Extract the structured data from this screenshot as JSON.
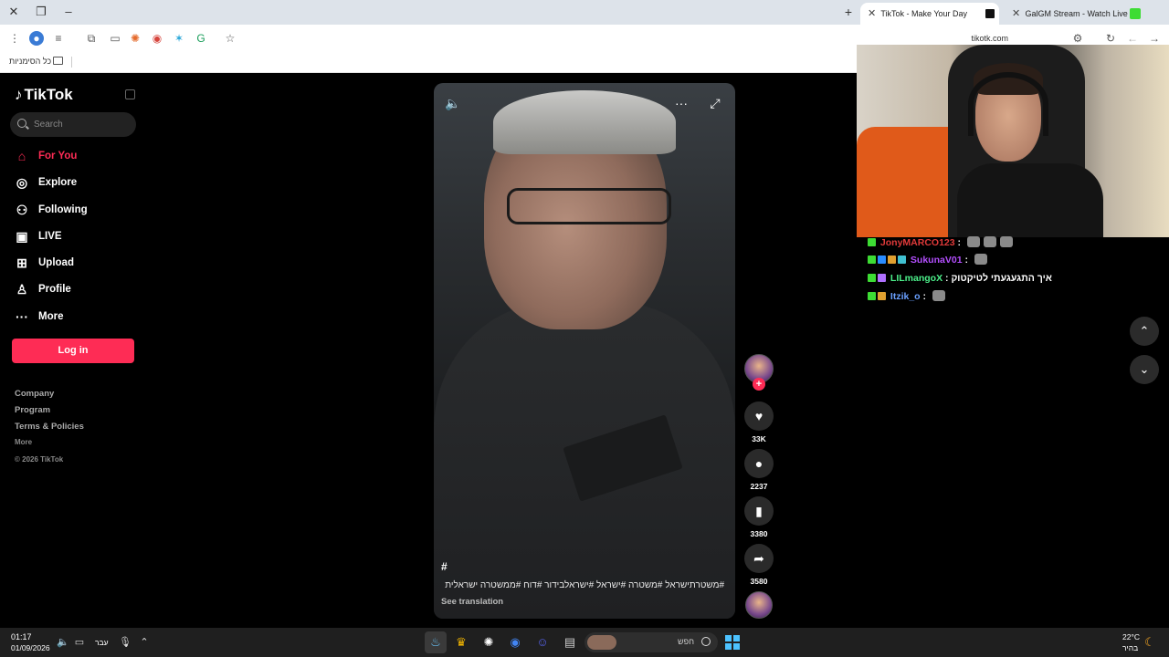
{
  "browser": {
    "tabs": [
      {
        "title": "TikTok - Make Your Day",
        "active": true
      },
      {
        "title": "GalGM Stream - Watch Live on",
        "active": false
      }
    ],
    "url": "tikotk.com",
    "bookmarks_label": "כל הסימניות"
  },
  "sidebar": {
    "logo": "TikTok",
    "search_placeholder": "Search",
    "nav": [
      {
        "label": "For You",
        "icon": "home-icon",
        "active": true
      },
      {
        "label": "Explore",
        "icon": "compass-icon"
      },
      {
        "label": "Following",
        "icon": "following-icon"
      },
      {
        "label": "LIVE",
        "icon": "live-icon"
      },
      {
        "label": "Upload",
        "icon": "upload-icon"
      },
      {
        "label": "Profile",
        "icon": "profile-icon"
      },
      {
        "label": "More",
        "icon": "more-icon"
      }
    ],
    "login_label": "Log in",
    "footer": {
      "company": "Company",
      "program": "Program",
      "terms": "Terms & Policies",
      "more": "More",
      "copyright": "© 2026 TikTok"
    }
  },
  "video": {
    "hashtag_symbol": "#",
    "caption": "#משטרתישראל #משטרה #ישראל #ישראלבידור #דוח #ממשטרה ישראלית",
    "see_translation": "See translation"
  },
  "actions": {
    "likes": "33K",
    "comments": "2237",
    "saves": "3380",
    "shares": "3580"
  },
  "chat": [
    {
      "user": "JonyMARCO123",
      "color": "#e03a3a",
      "message": ""
    },
    {
      "user": "SukunaV01",
      "color": "#b44fff",
      "message": ""
    },
    {
      "user": "LILmangoX",
      "color": "#4cf08a",
      "message": "איך התגעגעתי לטיקטוק"
    },
    {
      "user": "Itzik_o",
      "color": "#6aa0ff",
      "message": ""
    }
  ],
  "taskbar": {
    "time": "01:17",
    "date": "01/09/2026",
    "language": "עבר",
    "search_label": "חפש",
    "weather_temp": "22°C",
    "weather_desc": "בהיר"
  }
}
